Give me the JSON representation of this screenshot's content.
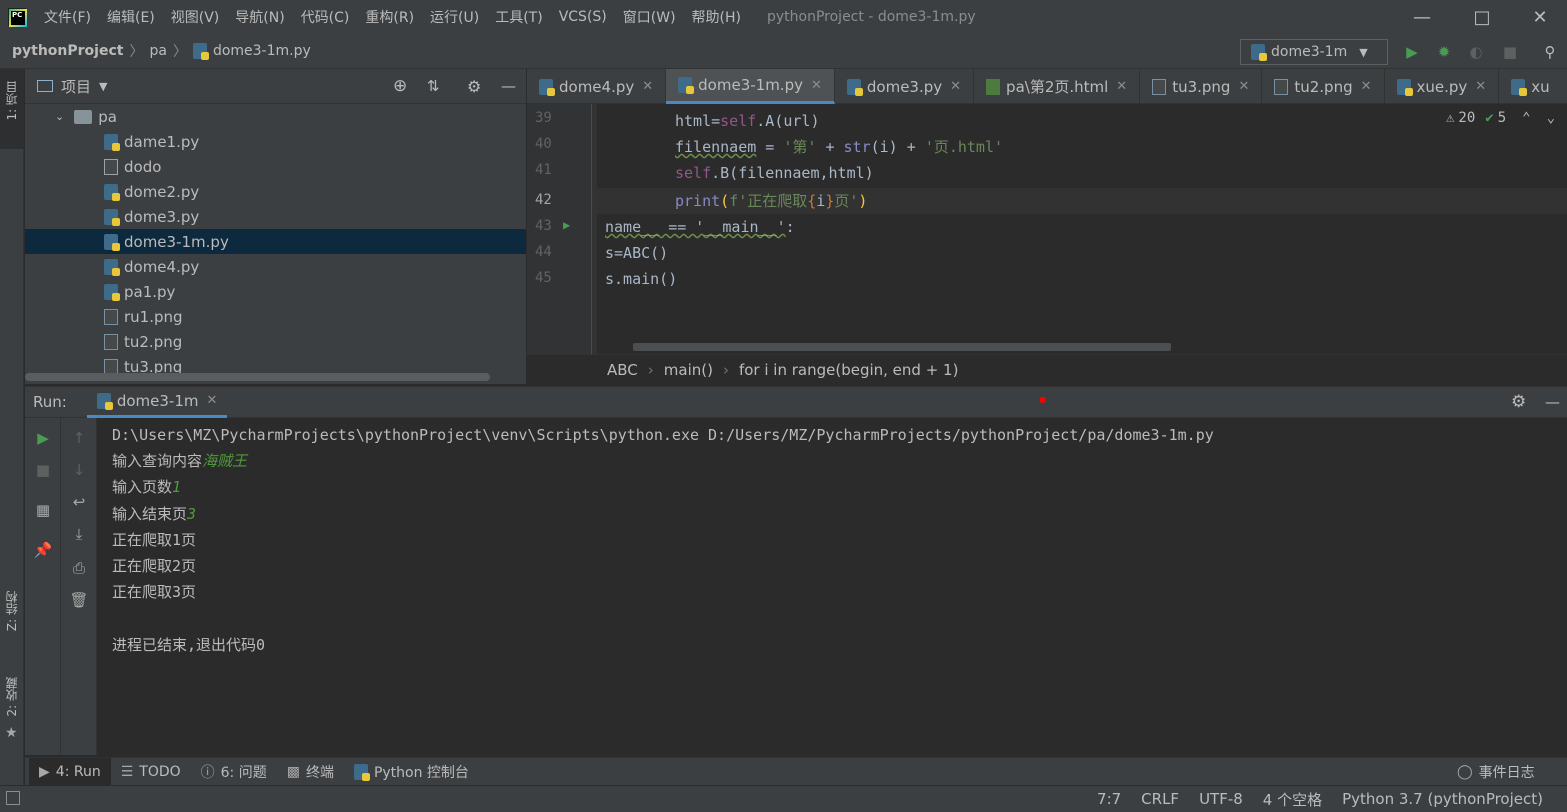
{
  "menubar": {
    "items": [
      "文件(F)",
      "编辑(E)",
      "视图(V)",
      "导航(N)",
      "代码(C)",
      "重构(R)",
      "运行(U)",
      "工具(T)",
      "VCS(S)",
      "窗口(W)",
      "帮助(H)"
    ],
    "title": "pythonProject - dome3-1m.py",
    "logo": "PC"
  },
  "navbar": {
    "project": "pythonProject",
    "folder": "pa",
    "file": "dome3-1m.py",
    "run_config": "dome3-1m"
  },
  "left_stripe": {
    "project_tab": "1: 项目",
    "structure_tab": "Z: 结构",
    "favorites_tab": "2: 收藏"
  },
  "project_panel": {
    "title": "项目",
    "folder": "pa",
    "files": [
      {
        "name": "dame1.py",
        "type": "py"
      },
      {
        "name": "dodo",
        "type": "plain"
      },
      {
        "name": "dome2.py",
        "type": "py"
      },
      {
        "name": "dome3.py",
        "type": "py"
      },
      {
        "name": "dome3-1m.py",
        "type": "py",
        "selected": true
      },
      {
        "name": "dome4.py",
        "type": "py"
      },
      {
        "name": "pa1.py",
        "type": "py"
      },
      {
        "name": "ru1.png",
        "type": "img"
      },
      {
        "name": "tu2.png",
        "type": "img"
      },
      {
        "name": "tu3.png",
        "type": "img"
      }
    ]
  },
  "editor_tabs": [
    {
      "label": "dome4.py",
      "type": "py"
    },
    {
      "label": "dome3-1m.py",
      "type": "py",
      "active": true
    },
    {
      "label": "dome3.py",
      "type": "py"
    },
    {
      "label": "pa\\第2页.html",
      "type": "html"
    },
    {
      "label": "tu3.png",
      "type": "img"
    },
    {
      "label": "tu2.png",
      "type": "img"
    },
    {
      "label": "xue.py",
      "type": "py"
    },
    {
      "label": "xu",
      "type": "py"
    }
  ],
  "editor": {
    "line_numbers": [
      "39",
      "40",
      "41",
      "42",
      "43",
      "44",
      "45"
    ],
    "current_line": "42",
    "warnings": "20",
    "ok_count": "5",
    "lines": {
      "l39": "html=self.A(url)",
      "l40": "filennaem = '第' + str(i) + '页.html'",
      "l41": "self.B(filennaem,html)",
      "l42": "print(f'正在爬取{i}页')",
      "l43": "name__ == '__main__':",
      "l44": "s=ABC()",
      "l45": "s.main()"
    }
  },
  "breadcrumbs": [
    "ABC",
    "main()",
    "for i in range(begin, end + 1)"
  ],
  "run_panel": {
    "label": "Run:",
    "tab": "dome3-1m",
    "console": {
      "command": "D:\\Users\\MZ\\PycharmProjects\\pythonProject\\venv\\Scripts\\python.exe D:/Users/MZ/PycharmProjects/pythonProject/pa/dome3-1m.py",
      "prompt1": "输入查询内容",
      "input1": "海贼王",
      "prompt2": "输入页数",
      "input2": "1",
      "prompt3": "输入结束页",
      "input3": "3",
      "out1": "正在爬取1页",
      "out2": "正在爬取2页",
      "out3": "正在爬取3页",
      "exit": "进程已结束,退出代码0"
    }
  },
  "tool_tabs": {
    "run": "4: Run",
    "todo": "TODO",
    "problems": "6: 问题",
    "terminal": "终端",
    "python_console": "Python 控制台",
    "event_log": "事件日志"
  },
  "statusbar": {
    "position": "7:7",
    "line_sep": "CRLF",
    "encoding": "UTF-8",
    "indent": "4 个空格",
    "interpreter": "Python 3.7 (pythonProject)"
  }
}
